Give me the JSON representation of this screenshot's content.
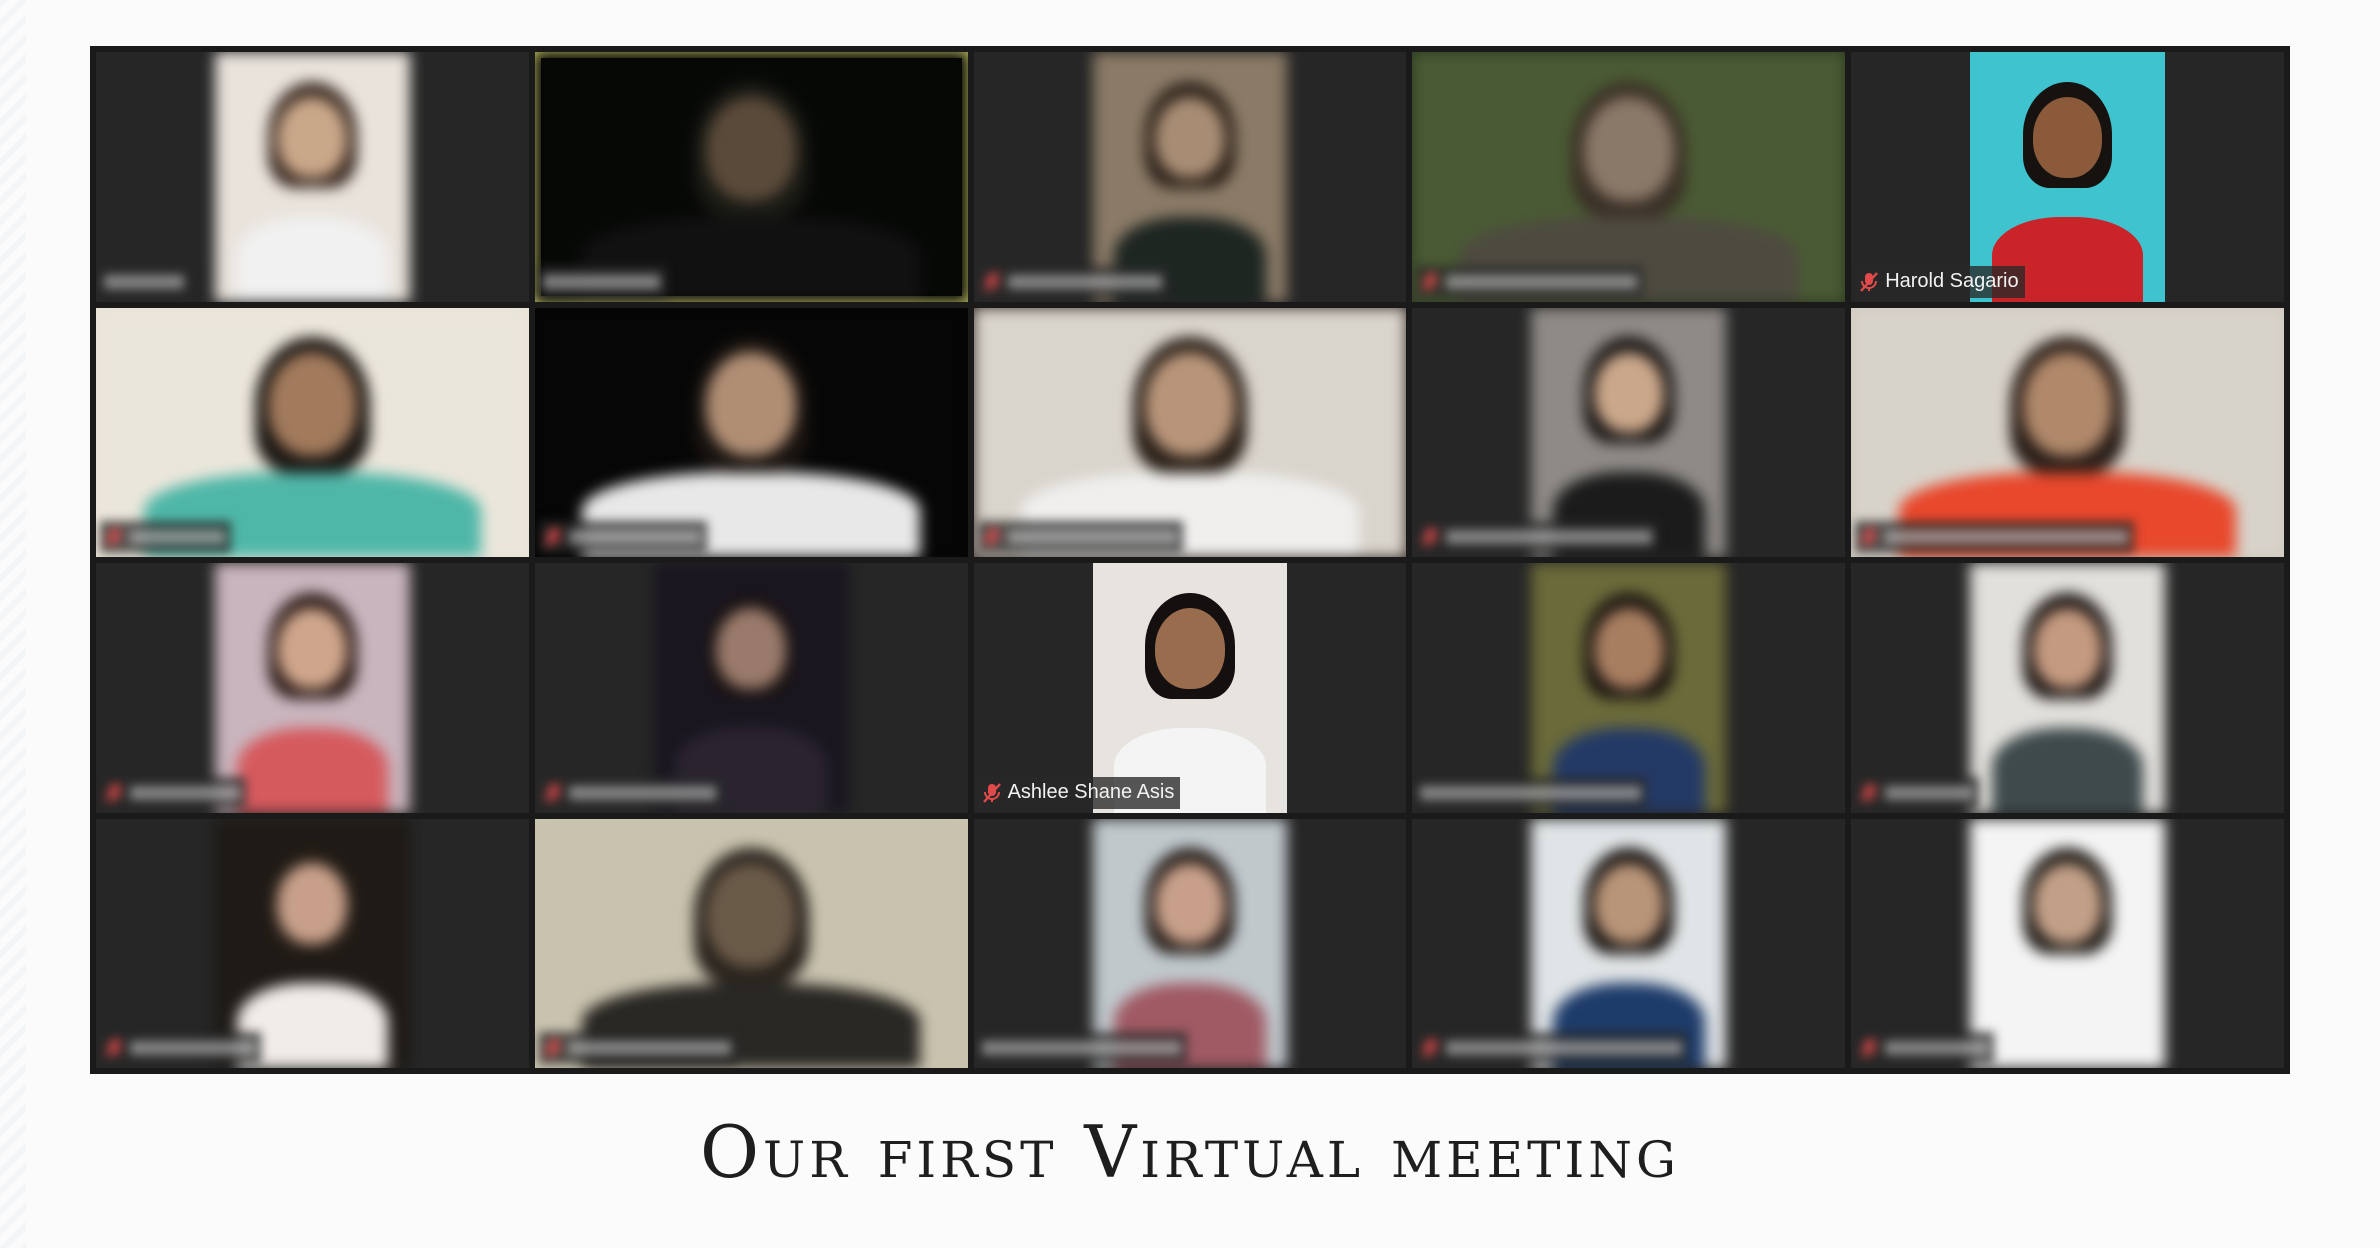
{
  "caption": "Our first Virtual meeting",
  "grid": {
    "rows": 4,
    "cols": 5,
    "tiles": [
      {
        "name": "",
        "muted": false,
        "blurred": true,
        "active": false,
        "bg": "#262626",
        "scene": "#e9e3dc",
        "skin": "#c9a789",
        "shirt": "#f1f1f1",
        "hair": "#3a2a22"
      },
      {
        "name": "",
        "muted": false,
        "blurred": true,
        "active": true,
        "bg": "#050505",
        "scene": "#060806",
        "skin": "#5a4a3a",
        "shirt": "#111",
        "hair": "#1a1a14"
      },
      {
        "name": "",
        "muted": true,
        "blurred": true,
        "active": false,
        "bg": "#262626",
        "scene": "#8a7a66",
        "skin": "#a88d74",
        "shirt": "#1e2622",
        "hair": "#2a2018"
      },
      {
        "name": "",
        "muted": true,
        "blurred": true,
        "active": false,
        "bg": "#2c3a22",
        "scene": "#4a5a34",
        "skin": "#8a7868",
        "shirt": "#4e4a40",
        "hair": "#3a3026"
      },
      {
        "name": "Harold Sagario",
        "muted": true,
        "blurred": false,
        "active": false,
        "bg": "#262626",
        "scene": "#3fc3cf",
        "skin": "#8a5a3a",
        "shirt": "#c8242a",
        "hair": "#161210"
      },
      {
        "name": "",
        "muted": true,
        "blurred": true,
        "active": false,
        "bg": "#e8e2d6",
        "scene": "#ebe6db",
        "skin": "#a27a5c",
        "shirt": "#4fb7a8",
        "hair": "#1c1814"
      },
      {
        "name": "",
        "muted": true,
        "blurred": true,
        "active": false,
        "bg": "#050505",
        "scene": "#060606",
        "skin": "#b08e74",
        "shirt": "#e8e8e8",
        "hair": "#1a1410"
      },
      {
        "name": "",
        "muted": true,
        "blurred": true,
        "active": false,
        "bg": "#3a302a",
        "scene": "#d9d4cc",
        "skin": "#b8957a",
        "shirt": "#f0efee",
        "hair": "#2a2018"
      },
      {
        "name": "",
        "muted": true,
        "blurred": true,
        "active": false,
        "bg": "#262626",
        "scene": "#8e8a86",
        "skin": "#caa78a",
        "shirt": "#1b1b1b",
        "hair": "#151211"
      },
      {
        "name": "",
        "muted": true,
        "blurred": true,
        "active": false,
        "bg": "#cfc8bd",
        "scene": "#d8d3ca",
        "skin": "#b0886a",
        "shirt": "#e8482c",
        "hair": "#2a1e18"
      },
      {
        "name": "",
        "muted": true,
        "blurred": true,
        "active": false,
        "bg": "#262626",
        "scene": "#c9b5be",
        "skin": "#cfa68c",
        "shirt": "#d55a5e",
        "hair": "#2a1a16"
      },
      {
        "name": "",
        "muted": true,
        "blurred": true,
        "active": false,
        "bg": "#262626",
        "scene": "#1a1620",
        "skin": "#9a7a6a",
        "shirt": "#2a2430",
        "hair": "#1a1414"
      },
      {
        "name": "Ashlee Shane Asis",
        "muted": true,
        "blurred": false,
        "active": false,
        "bg": "#262626",
        "scene": "#e7e4e0",
        "skin": "#9a6c4e",
        "shirt": "#f4f4f4",
        "hair": "#141010"
      },
      {
        "name": "",
        "muted": false,
        "blurred": true,
        "active": false,
        "bg": "#262626",
        "scene": "#6a6a3a",
        "skin": "#a87e60",
        "shirt": "#243a66",
        "hair": "#1a1410"
      },
      {
        "name": "",
        "muted": true,
        "blurred": true,
        "active": false,
        "bg": "#262626",
        "scene": "#e2e0dc",
        "skin": "#c49a80",
        "shirt": "#3e4a4c",
        "hair": "#1a1412"
      },
      {
        "name": "",
        "muted": true,
        "blurred": true,
        "active": false,
        "bg": "#262626",
        "scene": "#1e1a16",
        "skin": "#c8a08a",
        "shirt": "#f0ece8",
        "hair": "#241c16"
      },
      {
        "name": "",
        "muted": true,
        "blurred": true,
        "active": false,
        "bg": "#cac4b0",
        "scene": "#c8c2ae",
        "skin": "#6a5a48",
        "shirt": "#2a2824",
        "hair": "#2a241e"
      },
      {
        "name": "",
        "muted": false,
        "blurred": true,
        "active": false,
        "bg": "#262626",
        "scene": "#c0c8cc",
        "skin": "#c8a08a",
        "shirt": "#a05a64",
        "hair": "#241c18"
      },
      {
        "name": "",
        "muted": true,
        "blurred": true,
        "active": false,
        "bg": "#262626",
        "scene": "#e0e4e6",
        "skin": "#b89478",
        "shirt": "#1e3c6a",
        "hair": "#161210"
      },
      {
        "name": "",
        "muted": true,
        "blurred": true,
        "active": false,
        "bg": "#262626",
        "scene": "#f4f4f4",
        "skin": "#c2a088",
        "shirt": "#f4f4f4",
        "hair": "#1c1814"
      }
    ]
  }
}
